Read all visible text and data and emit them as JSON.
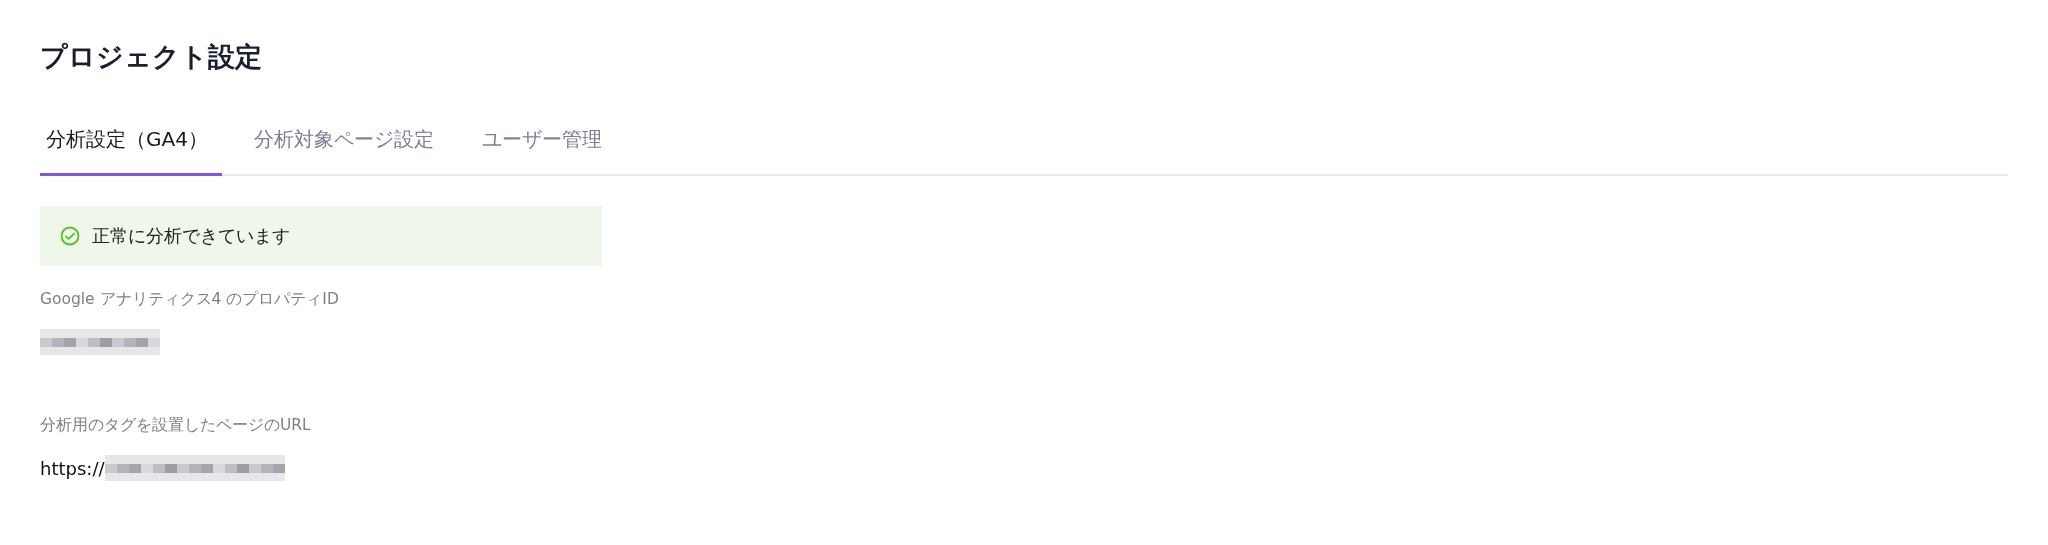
{
  "page": {
    "title": "プロジェクト設定"
  },
  "tabs": [
    {
      "label": "分析設定（GA4）",
      "selected": true
    },
    {
      "label": "分析対象ページ設定",
      "selected": false
    },
    {
      "label": "ユーザー管理",
      "selected": false
    }
  ],
  "status": {
    "kind": "success",
    "message": "正常に分析できています"
  },
  "fields": [
    {
      "label": "Google アナリティクス4 のプロパティID",
      "redacted": true
    },
    {
      "label": "分析用のタグを設置したページのURL",
      "value": "https://",
      "redacted": true
    }
  ]
}
